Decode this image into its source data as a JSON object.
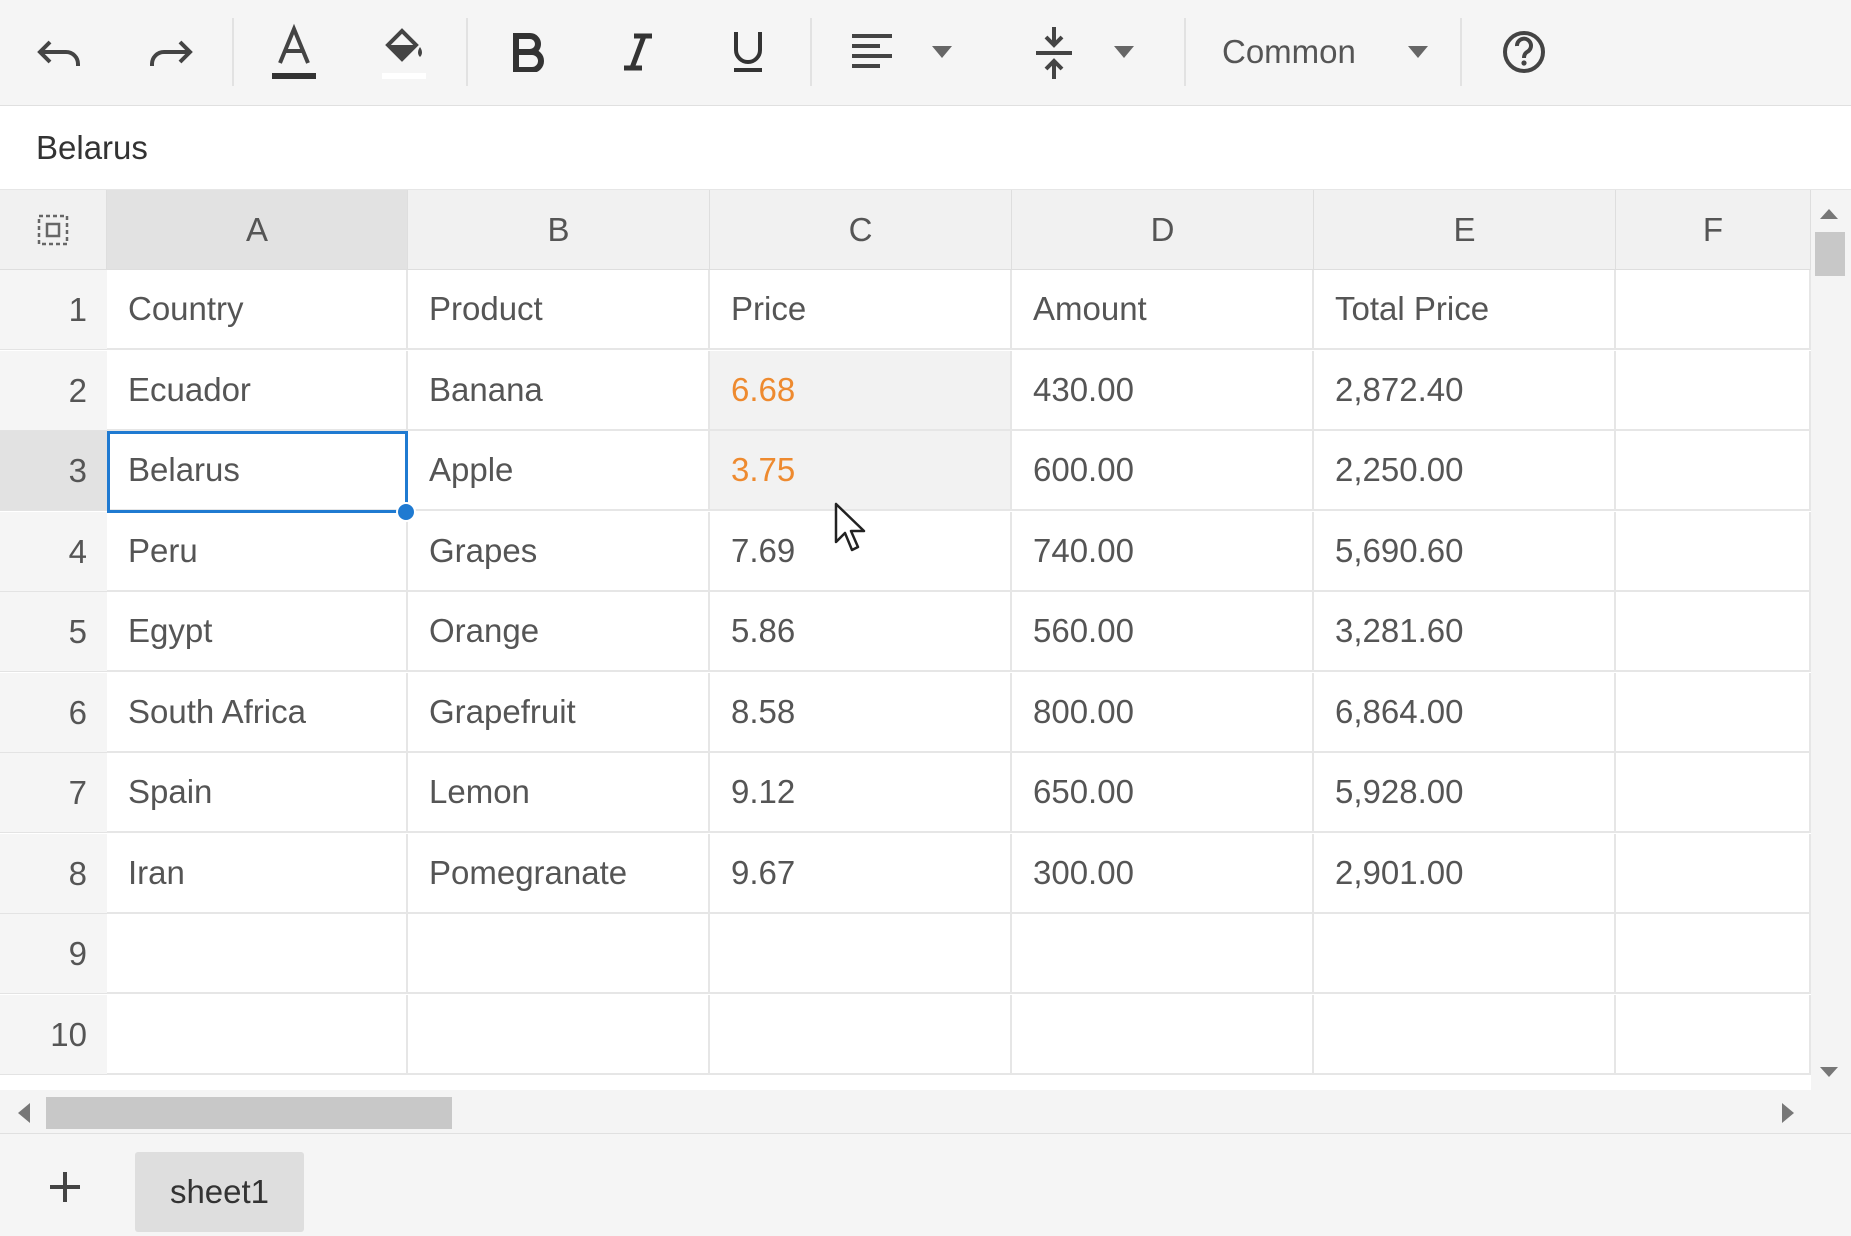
{
  "toolbar": {
    "undo_icon": "undo-icon",
    "redo_icon": "redo-icon",
    "font_color_icon": "font-color-icon",
    "fill_color_icon": "fill-color-icon",
    "bold_icon": "bold-icon",
    "italic_icon": "italic-icon",
    "underline_icon": "underline-icon",
    "align_icon": "align-left-icon",
    "valign_icon": "vertical-align-icon",
    "format_label": "Common",
    "help_icon": "help-icon"
  },
  "formula_bar": {
    "value": "Belarus"
  },
  "grid": {
    "columns": [
      "A",
      "B",
      "C",
      "D",
      "E",
      "F"
    ],
    "rows": [
      "1",
      "2",
      "3",
      "4",
      "5",
      "6",
      "7",
      "8",
      "9",
      "10"
    ],
    "cells": [
      [
        "Country",
        "Product",
        "Price",
        "Amount",
        "Total Price",
        ""
      ],
      [
        "Ecuador",
        "Banana",
        "6.68",
        "430.00",
        "2,872.40",
        ""
      ],
      [
        "Belarus",
        "Apple",
        "3.75",
        "600.00",
        "2,250.00",
        ""
      ],
      [
        "Peru",
        "Grapes",
        "7.69",
        "740.00",
        "5,690.60",
        ""
      ],
      [
        "Egypt",
        "Orange",
        "5.86",
        "560.00",
        "3,281.60",
        ""
      ],
      [
        "South Africa",
        "Grapefruit",
        "8.58",
        "800.00",
        "6,864.00",
        ""
      ],
      [
        "Spain",
        "Lemon",
        "9.12",
        "650.00",
        "5,928.00",
        ""
      ],
      [
        "Iran",
        "Pomegranate",
        "9.67",
        "300.00",
        "2,901.00",
        ""
      ],
      [
        "",
        "",
        "",
        "",
        "",
        ""
      ],
      [
        "",
        "",
        "",
        "",
        "",
        ""
      ]
    ],
    "selected_cell": "A3",
    "accent_color": "#1f7ad1",
    "highlight_text_color": "#ee8a2f"
  },
  "sheets": {
    "add_icon": "plus-icon",
    "tabs": [
      "sheet1"
    ]
  }
}
